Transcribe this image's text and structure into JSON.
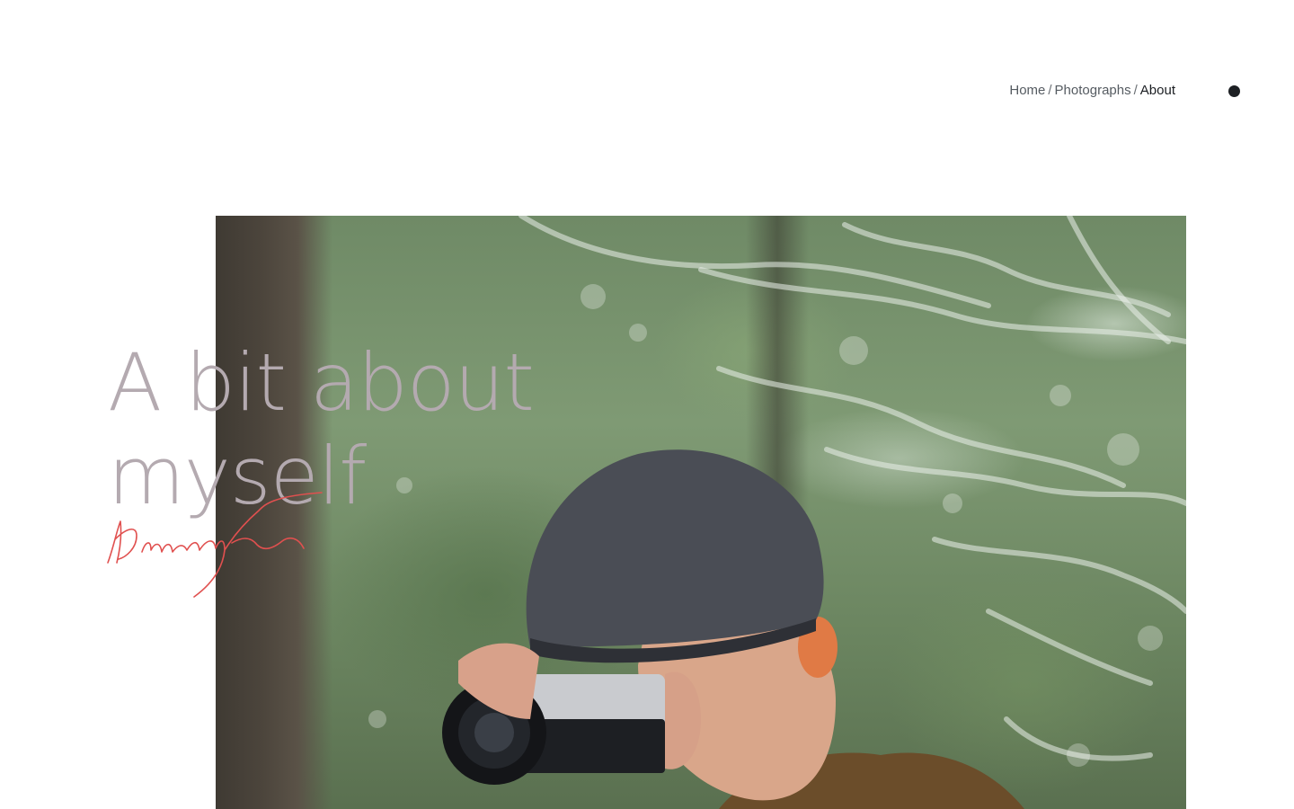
{
  "breadcrumb": {
    "home": "Home",
    "photographs": "Photographs",
    "current": "About",
    "separator": "/"
  },
  "menu": {
    "icon": "menu-dot-icon"
  },
  "hero": {
    "title_line1": "A bit about",
    "title_line2": "myself",
    "title_color": "#b4aab0",
    "signature_color": "#e0504f",
    "photo_subject": "man-with-camera-photo"
  }
}
